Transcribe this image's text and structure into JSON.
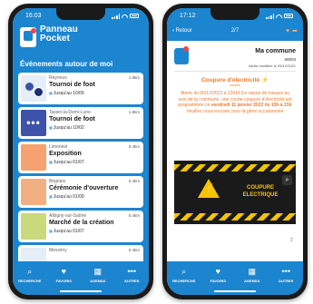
{
  "left_phone": {
    "status_time": "16:03",
    "app_name_line1": "Panneau",
    "app_name_line2": "Pocket",
    "section_title": "Évènements autour de moi",
    "events": [
      {
        "city": "Reyrieux",
        "distance": "1.8km",
        "title": "Tournoi de foot",
        "date": "Jusqu'au 10/09"
      },
      {
        "city": "Tassin-la-Demi-Lune",
        "distance": "1.8km",
        "title": "Tournoi de foot",
        "date": "Jusqu'au 10/02"
      },
      {
        "city": "Limonest",
        "distance": "0.4km",
        "title": "Exposition",
        "date": "Jusqu'au 01/07"
      },
      {
        "city": "Brignais",
        "distance": "0.4km",
        "title": "Cérémonie d'ouverture",
        "date": "Jusqu'au 01/09"
      },
      {
        "city": "Albigny-sur-Saône",
        "distance": "0.4km",
        "title": "Marché de la création",
        "date": "Jusqu'au 01/07"
      },
      {
        "city": "Messimy",
        "distance": "0.4km"
      }
    ],
    "tabs": [
      {
        "label": "RECHERCHE",
        "icon": "search-icon"
      },
      {
        "label": "FAVORIS",
        "icon": "heart-icon"
      },
      {
        "label": "AGENDA",
        "icon": "calendar-icon"
      },
      {
        "label": "AUTRES",
        "icon": "more-icon"
      }
    ]
  },
  "right_phone": {
    "status_time": "17:12",
    "back_label": "Retour",
    "page_indicator": "2/7",
    "commune": "Ma commune",
    "zip": "69003",
    "modified": "Alerte modifiée le 05/12/2021",
    "alert_title": "Coupure d'électricité",
    "alert_stars": "******",
    "alert_body_pre": "Alerte du 06/12/2021 à 12h16 En raison de travaux au sein de la commune, une courte coupure d'électricité est programmée ce",
    "alert_body_bold": "vendredi 11 janvier 2022 de 13h à 15h",
    "alert_body_post": "Veuillez nous excuser pour la gêne occasionnée",
    "banner_text": "COUPURE ELECTRIQUE",
    "tabs": [
      {
        "label": "RECHERCHE",
        "icon": "search-icon"
      },
      {
        "label": "FAVORIS",
        "icon": "heart-icon"
      },
      {
        "label": "AGENDA",
        "icon": "calendar-icon"
      },
      {
        "label": "AUTRES",
        "icon": "more-icon"
      }
    ]
  },
  "colors": {
    "primary": "#1c85cf",
    "alert": "#f07a2a",
    "warning": "#f5c400"
  }
}
